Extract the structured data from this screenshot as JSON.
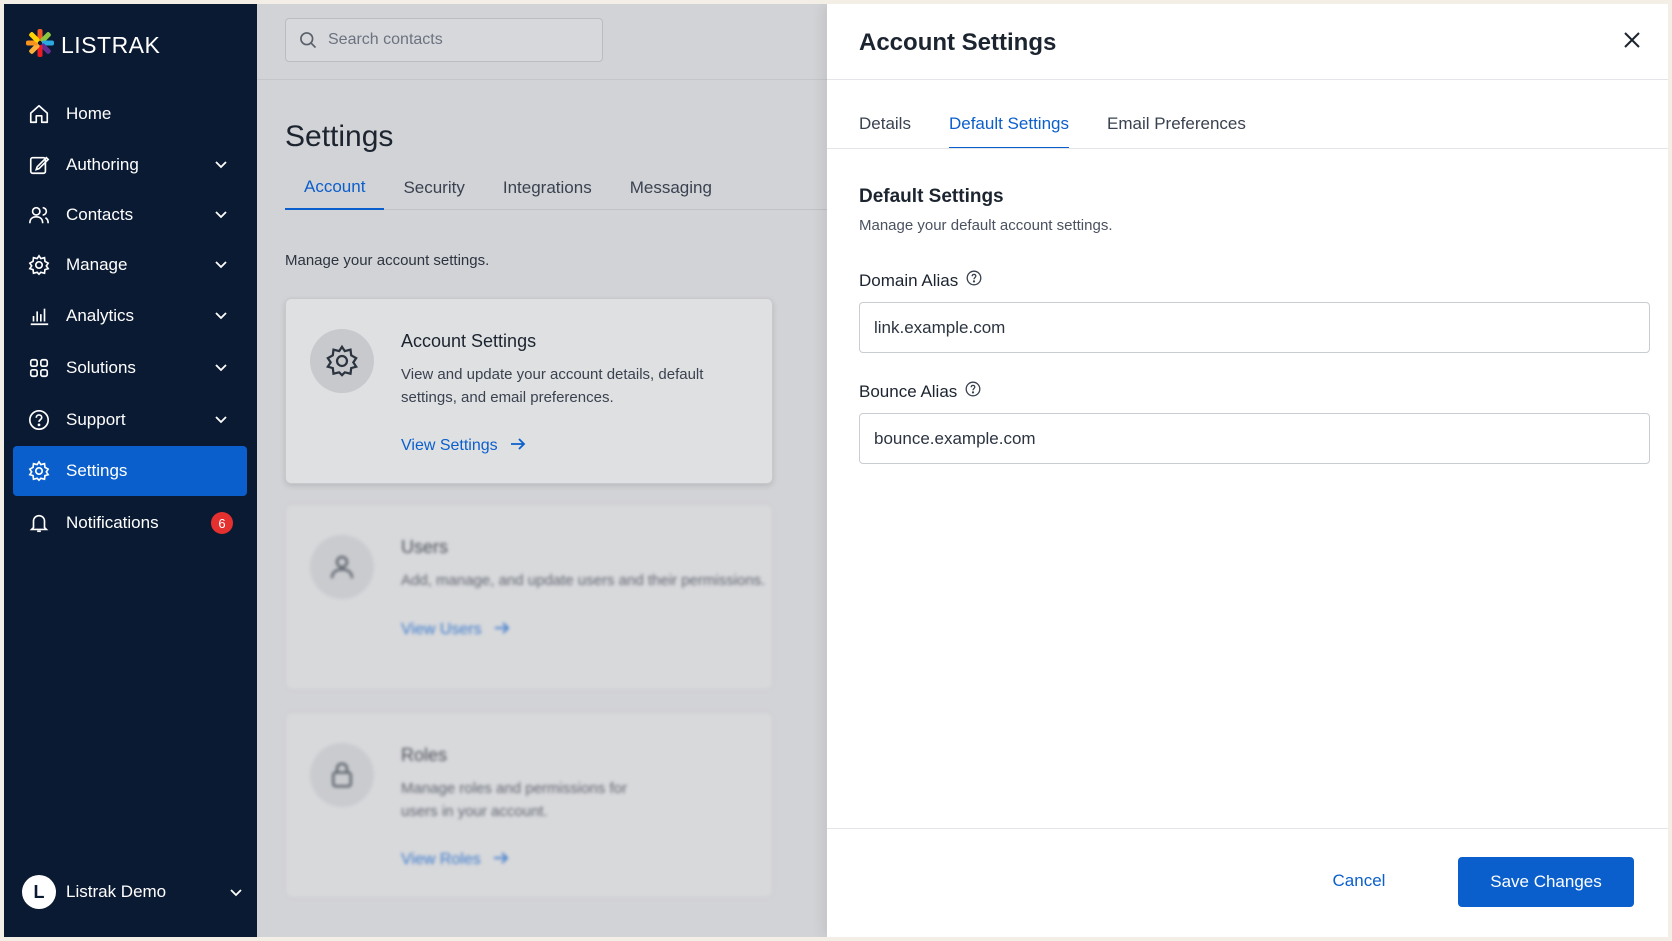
{
  "brand": {
    "name": "LISTRAK"
  },
  "sidebar": {
    "items": [
      {
        "label": "Home",
        "icon": "home-icon"
      },
      {
        "label": "Authoring",
        "icon": "edit-icon"
      },
      {
        "label": "Contacts",
        "icon": "contacts-icon"
      },
      {
        "label": "Manage",
        "icon": "gear-icon"
      },
      {
        "label": "Analytics",
        "icon": "analytics-icon"
      },
      {
        "label": "Solutions",
        "icon": "grid-icon"
      },
      {
        "label": "Support",
        "icon": "help-icon"
      },
      {
        "label": "Settings",
        "icon": "gear-icon",
        "active": true
      },
      {
        "label": "Notifications",
        "icon": "bell-icon",
        "badge": "6"
      }
    ],
    "user": {
      "initial": "L",
      "name": "Listrak Demo"
    }
  },
  "main": {
    "search_placeholder": "Search contacts",
    "title": "Settings",
    "tabs": [
      "Account",
      "Security",
      "Integrations",
      "Messaging"
    ],
    "active_tab": "Account",
    "description": "Manage your account settings.",
    "cards": [
      {
        "title": "Account Settings",
        "description": "View and update your account details, default settings, and email preferences.",
        "link": "View Settings"
      },
      {
        "title": "Users",
        "description": "Add, manage, and update users and their permissions.",
        "link": "View Users"
      },
      {
        "title": "Roles",
        "description": "Manage roles and permissions for users in your account.",
        "link": "View Roles"
      }
    ]
  },
  "drawer": {
    "title": "Account Settings",
    "tabs": [
      "Details",
      "Default Settings",
      "Email Preferences"
    ],
    "active_tab": "Default Settings",
    "section_title": "Default Settings",
    "section_desc": "Manage your default account settings.",
    "fields": [
      {
        "label": "Domain Alias",
        "value": "link.example.com"
      },
      {
        "label": "Bounce Alias",
        "value": "bounce.example.com"
      }
    ],
    "cancel_label": "Cancel",
    "save_label": "Save Changes"
  },
  "colors": {
    "accent": "#0b5fcc",
    "sidebar_bg": "#0b1a33",
    "badge": "#e53030"
  }
}
